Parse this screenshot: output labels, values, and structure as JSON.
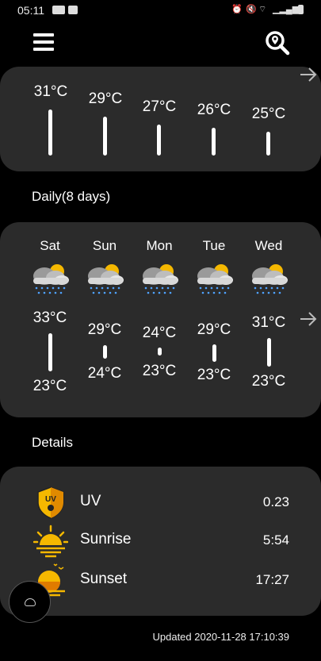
{
  "status_bar": {
    "time": "05:11"
  },
  "hourly": {
    "items": [
      {
        "temp": "31°C",
        "value": 31
      },
      {
        "temp": "29°C",
        "value": 29
      },
      {
        "temp": "27°C",
        "value": 27
      },
      {
        "temp": "26°C",
        "value": 26
      },
      {
        "temp": "25°C",
        "value": 25
      }
    ]
  },
  "daily": {
    "label": "Daily(8 days)",
    "items": [
      {
        "day": "Sat",
        "hi": "33°C",
        "lo": "23°C"
      },
      {
        "day": "Sun",
        "hi": "29°C",
        "lo": "24°C"
      },
      {
        "day": "Mon",
        "hi": "24°C",
        "lo": "23°C"
      },
      {
        "day": "Tue",
        "hi": "29°C",
        "lo": "23°C"
      },
      {
        "day": "Wed",
        "hi": "31°C",
        "lo": "23°C"
      }
    ]
  },
  "details": {
    "label": "Details",
    "items": [
      {
        "name": "UV",
        "value": "0.23",
        "icon": "uv-icon"
      },
      {
        "name": "Sunrise",
        "value": "5:54",
        "icon": "sunrise-icon"
      },
      {
        "name": "Sunset",
        "value": "17:27",
        "icon": "sunset-icon"
      }
    ]
  },
  "uv_icon_text": "UV",
  "updated": "Updated 2020-11-28 17:10:39",
  "colors": {
    "background": "#000000",
    "card": "#2b2b2b",
    "text": "#ffffff",
    "sun": "#f5b800"
  }
}
